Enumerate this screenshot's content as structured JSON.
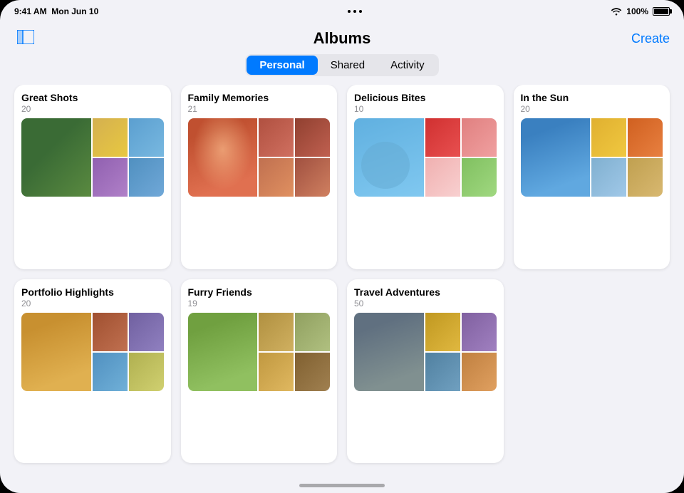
{
  "status_bar": {
    "time": "9:41 AM",
    "date": "Mon Jun 10",
    "battery_percent": "100%"
  },
  "nav": {
    "title": "Albums",
    "create_label": "Create"
  },
  "segmented_control": {
    "segments": [
      {
        "id": "personal",
        "label": "Personal",
        "active": true
      },
      {
        "id": "shared",
        "label": "Shared",
        "active": false
      },
      {
        "id": "activity",
        "label": "Activity",
        "active": false
      }
    ]
  },
  "albums": [
    {
      "id": "great-shots",
      "title": "Great Shots",
      "count": "20",
      "colors": [
        "#4a7c3f",
        "#e8c547",
        "#6baed6",
        "#9e9ac8",
        "#fd8d3c",
        "#74c476"
      ]
    },
    {
      "id": "family-memories",
      "title": "Family Memories",
      "count": "21",
      "colors": [
        "#c2523c",
        "#e8854a",
        "#8b3a3a",
        "#d4956a",
        "#a05c3a",
        "#c47a5a"
      ]
    },
    {
      "id": "delicious-bites",
      "title": "Delicious Bites",
      "count": "10",
      "colors": [
        "#e84040",
        "#f0a0a0",
        "#50c050",
        "#c0d060",
        "#9090e0",
        "#60b080"
      ]
    },
    {
      "id": "in-the-sun",
      "title": "In the Sun",
      "count": "20",
      "colors": [
        "#4a8cbf",
        "#e8c040",
        "#d06020",
        "#8ab0d0",
        "#c0a050",
        "#6090b0"
      ]
    },
    {
      "id": "portfolio-highlights",
      "title": "Portfolio Highlights",
      "count": "20",
      "colors": [
        "#d4a030",
        "#c06030",
        "#8060a0",
        "#60a0d0",
        "#c0c060",
        "#405080"
      ]
    },
    {
      "id": "furry-friends",
      "title": "Furry Friends",
      "count": "19",
      "colors": [
        "#80a050",
        "#c09840",
        "#a07030",
        "#608050",
        "#d0a060",
        "#507040"
      ]
    },
    {
      "id": "travel-adventures",
      "title": "Travel Adventures",
      "count": "50",
      "colors": [
        "#708090",
        "#c0a020",
        "#9060a0",
        "#5080a0",
        "#c08040",
        "#607090"
      ]
    }
  ]
}
